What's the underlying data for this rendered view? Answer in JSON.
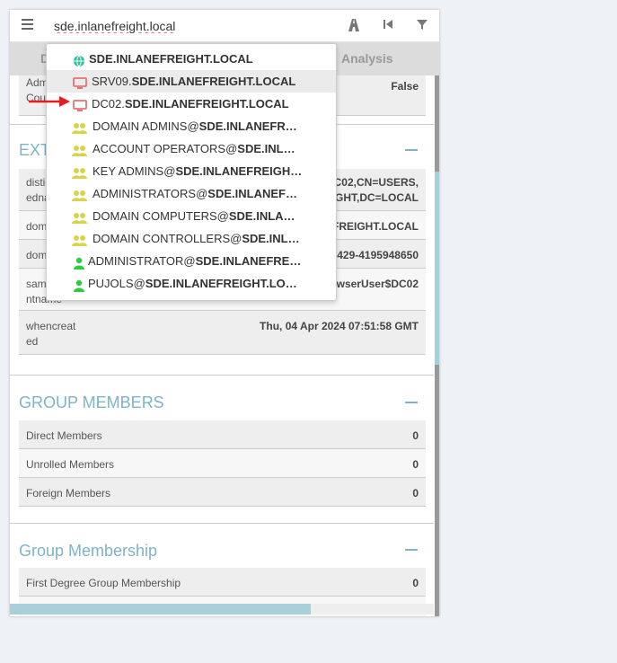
{
  "search": {
    "value": "sde.inlanefreight.local"
  },
  "tabs": [
    {
      "label": "D"
    },
    {
      "label": "Analysis"
    }
  ],
  "top_partial": {
    "left": "Adm\nCou",
    "right": "False"
  },
  "extra": {
    "title": "EXT",
    "rows": [
      {
        "k": "disti\nedna",
        "v": "DC02,CN=USERS,\nGHT,DC=LOCAL"
      },
      {
        "k": "dom",
        "v": "FREIGHT.LOCAL"
      },
      {
        "k": "dom",
        "v": "2429-4195948650"
      },
      {
        "k": "sam\nntname",
        "v": "wserUser$DC02"
      },
      {
        "k": "whencreat\ned",
        "v": "Thu, 04 Apr 2024 07:51:58 GMT"
      }
    ]
  },
  "group_members": {
    "title": "GROUP MEMBERS",
    "rows": [
      {
        "k": "Direct Members",
        "v": "0"
      },
      {
        "k": "Unrolled Members",
        "v": "0"
      },
      {
        "k": "Foreign Members",
        "v": "0"
      }
    ]
  },
  "group_membership": {
    "title": "Group Membership",
    "rows": [
      {
        "k": "First Degree Group Membership",
        "v": "0"
      }
    ]
  },
  "dropdown": [
    {
      "icon": "domain-globe-icon",
      "color": "#2bbf9b",
      "prefix": "",
      "bold": "SDE.INLANEFREIGHT.LOCAL"
    },
    {
      "icon": "computer-icon",
      "color": "#e57373",
      "prefix": "SRV09.",
      "bold": "SDE.INLANEFREIGHT.LOCAL"
    },
    {
      "icon": "computer-icon",
      "color": "#e57373",
      "prefix": "DC02.",
      "bold": "SDE.INLANEFREIGHT.LOCAL"
    },
    {
      "icon": "group-icon",
      "color": "#d8d44a",
      "prefix": "DOMAIN ADMINS@",
      "bold": "SDE.INLANEFR…"
    },
    {
      "icon": "group-icon",
      "color": "#d8d44a",
      "prefix": "ACCOUNT OPERATORS@",
      "bold": "SDE.INL…"
    },
    {
      "icon": "group-icon",
      "color": "#d8d44a",
      "prefix": "KEY ADMINS@",
      "bold": "SDE.INLANEFREIGH…"
    },
    {
      "icon": "group-icon",
      "color": "#d8d44a",
      "prefix": "ADMINISTRATORS@",
      "bold": "SDE.INLANEF…"
    },
    {
      "icon": "group-icon",
      "color": "#d8d44a",
      "prefix": "DOMAIN COMPUTERS@",
      "bold": "SDE.INLA…"
    },
    {
      "icon": "group-icon",
      "color": "#d8d44a",
      "prefix": "DOMAIN CONTROLLERS@",
      "bold": "SDE.INL…"
    },
    {
      "icon": "user-icon",
      "color": "#2ecc40",
      "prefix": "ADMINISTRATOR@",
      "bold": "SDE.INLANEFRE…"
    },
    {
      "icon": "user-icon",
      "color": "#2ecc40",
      "prefix": "PUJOLS@",
      "bold": "SDE.INLANEFREIGHT.LO…"
    }
  ],
  "colors": {
    "accent": "#7fb3c6",
    "arrow": "#e02020"
  }
}
